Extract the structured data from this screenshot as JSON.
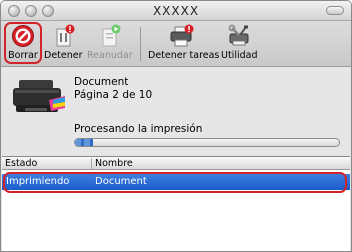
{
  "window": {
    "title": "XXXXX"
  },
  "toolbar": {
    "delete_label": "Borrar",
    "stop_label": "Detener",
    "resume_label": "Reanudar",
    "stop_jobs_label": "Detener tareas",
    "utility_label": "Utilidad"
  },
  "job": {
    "document": "Document",
    "page_info": "Página 2 de 10",
    "status": "Procesando la impresión",
    "progress_fraction": 0.07
  },
  "queue": {
    "columns": [
      "Estado",
      "Nombre"
    ],
    "rows": [
      {
        "status": "Imprimiendo",
        "name": "Document"
      }
    ]
  },
  "colors": {
    "highlight": "#d2232a",
    "selection": "#2f6cc5"
  },
  "icons": [
    "delete-icon",
    "stop-icon",
    "resume-icon",
    "stop-jobs-icon",
    "utility-icon",
    "printer-icon"
  ]
}
